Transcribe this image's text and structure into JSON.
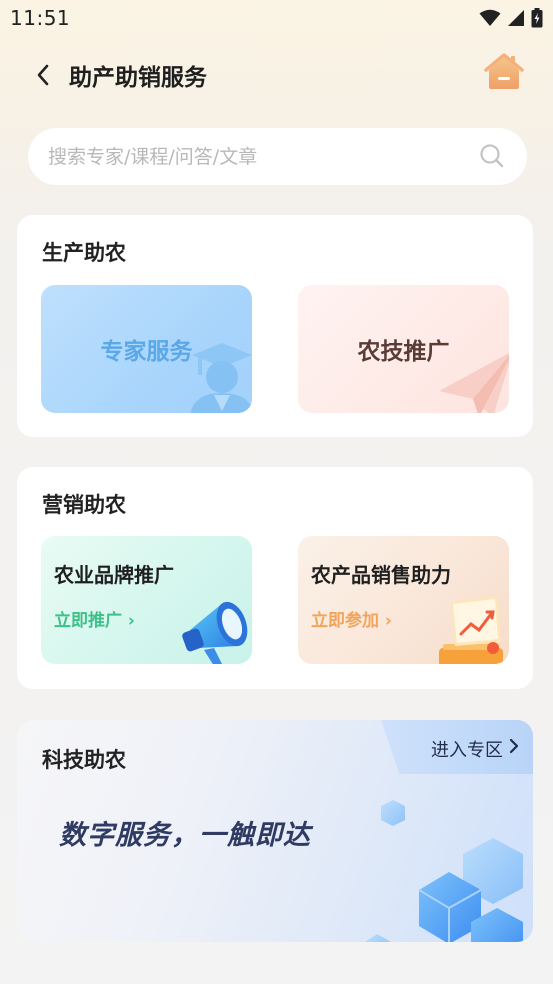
{
  "status_bar": {
    "time": "11:51"
  },
  "header": {
    "title": "助产助销服务"
  },
  "search": {
    "placeholder": "搜索专家/课程/问答/文章"
  },
  "production": {
    "title": "生产助农",
    "tiles": [
      {
        "label": "专家服务",
        "color": "#59a6e6"
      },
      {
        "label": "农技推广",
        "color": "#5a3c37"
      }
    ]
  },
  "marketing": {
    "title": "营销助农",
    "tiles": [
      {
        "title": "农业品牌推广",
        "link": "立即推广 ›",
        "link_color": "#3fc08a"
      },
      {
        "title": "农产品销售助力",
        "link": "立即参加 ›",
        "link_color": "#f3a45c"
      }
    ]
  },
  "tech": {
    "title": "科技助农",
    "enter_label": "进入专区",
    "slogan": "数字服务，一触即达"
  }
}
